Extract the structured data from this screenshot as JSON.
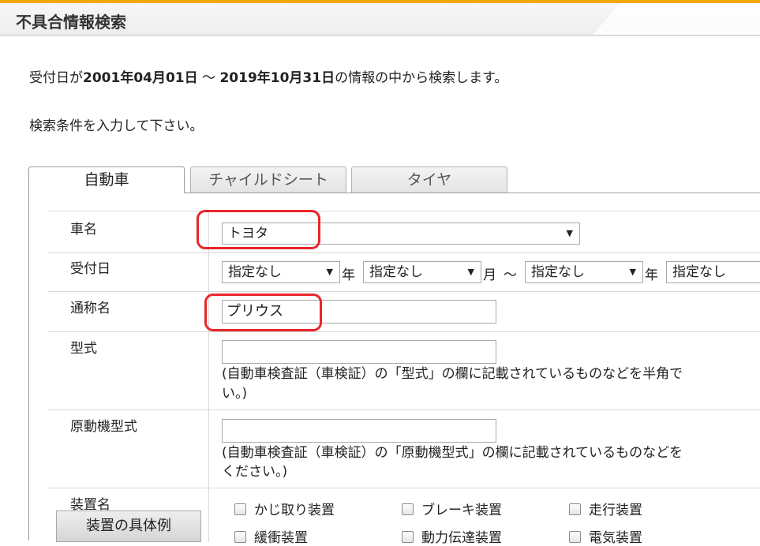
{
  "header": {
    "title": "不具合情報検索"
  },
  "info": {
    "prefix": "受付日が",
    "start_date": "2001年04月01日",
    "tilde": " ～ ",
    "end_date": "2019年10月31日",
    "suffix": "の情報の中から検索します。"
  },
  "instruction": "検索条件を入力して下さい。",
  "tabs": [
    {
      "label": "自動車",
      "active": true
    },
    {
      "label": "チャイルドシート",
      "active": false
    },
    {
      "label": "タイヤ",
      "active": false
    }
  ],
  "form": {
    "car_name": {
      "label": "車名",
      "value": "トヨタ"
    },
    "date": {
      "label": "受付日",
      "from_year": "指定なし",
      "year_unit": "年",
      "from_month": "指定なし",
      "month_unit": "月",
      "tilde": "～",
      "to_year": "指定なし",
      "to_month": "指定なし"
    },
    "common_name": {
      "label": "通称名",
      "value": "プリウス"
    },
    "model": {
      "label": "型式",
      "value": "",
      "hint_line1": "(自動車検査証（車検証）の「型式」の欄に記載されているものなどを半角で",
      "hint_line2": "い。)"
    },
    "engine_model": {
      "label": "原動機型式",
      "value": "",
      "hint_line1": "(自動車検査証（車検証）の「原動機型式」の欄に記載されているものなどを",
      "hint_line2": "ください。)"
    },
    "device": {
      "label": "装置名",
      "example_button": "装置の具体例",
      "checkboxes": [
        "かじ取り装置",
        "ブレーキ装置",
        "走行装置",
        "緩衝装置",
        "動力伝達装置",
        "電気装置"
      ]
    }
  },
  "colors": {
    "accent": "#f5a800",
    "highlight": "#e8262b"
  },
  "arrow_glyph": "▼"
}
